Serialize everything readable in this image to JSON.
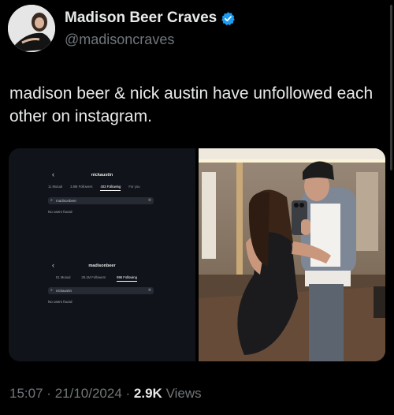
{
  "author": {
    "display_name": "Madison Beer Craves",
    "handle": "@madisoncraves",
    "verified_color": "#1d9bf0"
  },
  "tweet": {
    "text": "madison beer & nick austin have unfollowed each other on instagram."
  },
  "screenshot_1": {
    "back": "‹",
    "username": "nickaustin",
    "tabs": [
      "11 Mutual",
      "3.8M Followers",
      "403 Following",
      "For you"
    ],
    "active_tab": 2,
    "search_value": "madisonbeer",
    "no_results": "No users found"
  },
  "screenshot_2": {
    "back": "‹",
    "username": "madisonbeer",
    "tabs": [
      "81 Mutual",
      "39.1M Followers",
      "996 Following"
    ],
    "active_tab": 2,
    "search_value": "nickaustin",
    "no_results": "No users found"
  },
  "footer": {
    "time": "15:07",
    "date": "21/10/2024",
    "views_count": "2.9K",
    "views_label": "Views",
    "separator": "·"
  }
}
